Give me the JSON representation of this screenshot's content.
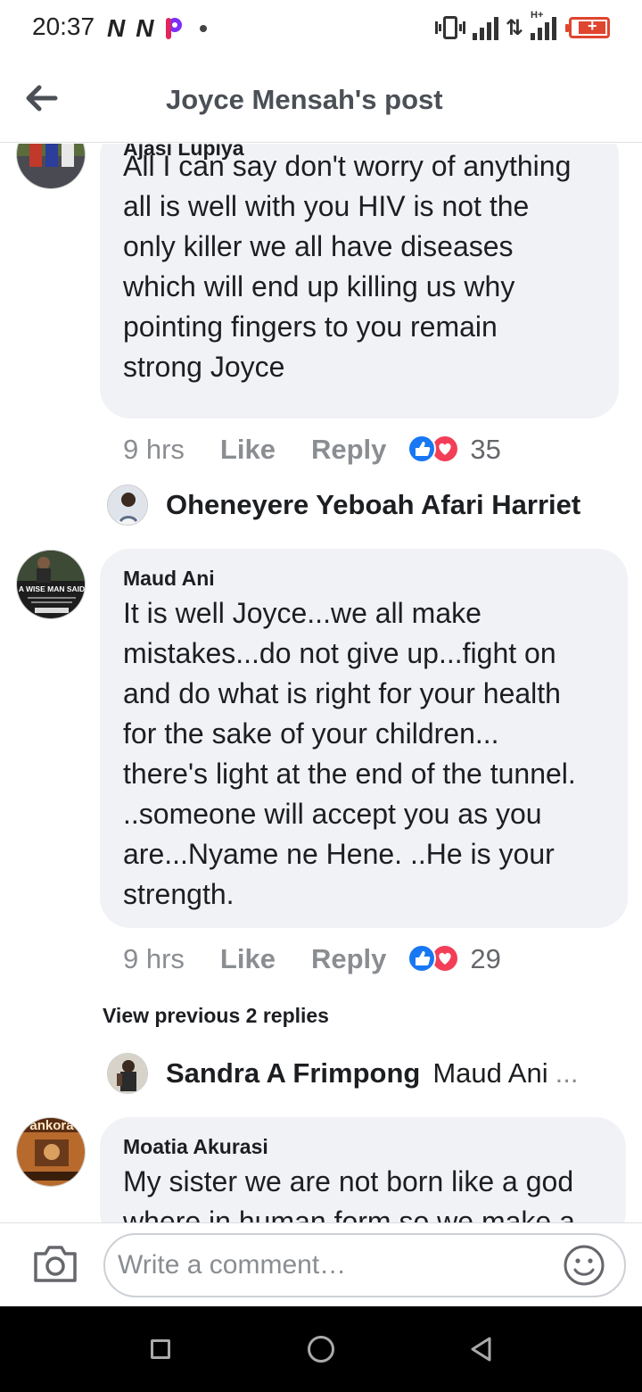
{
  "status_bar": {
    "time": "20:37",
    "icons": [
      "netflix-n-icon",
      "netflix-n-icon",
      "picsart-p-icon",
      "notification-dot-icon",
      "vibrate-icon",
      "signal-icon",
      "data-arrows-icon",
      "signal-hplus-icon",
      "battery-charging-icon"
    ],
    "data_arrows": "⇅",
    "hplus_label": "H+"
  },
  "header": {
    "title": "Joyce Mensah's post",
    "back_icon": "arrow-left-icon"
  },
  "comments": [
    {
      "author": "Ajasi Lupiya",
      "text": "All I can say don't worry of anything all is well with you HIV is not the only killer we all have diseases which will end up killing us why pointing fingers to you remain strong Joyce",
      "lines": [
        "All I can say don't worry of anything",
        "all is well with you HIV is not the",
        "only killer we all have diseases",
        "which will end up killing us why",
        "pointing fingers to you remain",
        "strong Joyce"
      ],
      "time": "9 hrs",
      "like_label": "Like",
      "reply_label": "Reply",
      "reactions": [
        "like",
        "love"
      ],
      "reaction_count": "35",
      "reply_preview": {
        "name": "Oheneyere Yeboah Afari Harriet",
        "snippet": ""
      }
    },
    {
      "author": "Maud Ani",
      "avatar_text": "A WISE MAN SAID",
      "text": "It is well Joyce...we all make mistakes...do not give up...fight on and do what is right for your health for the sake of your children... there's light at the end of the tunnel. ..someone will accept you as you are...Nyame ne Hene. ..He is your strength.",
      "lines": [
        "It is well Joyce...we all make",
        "mistakes...do not give up...fight on",
        "and do what is right for your health",
        "for the sake of your children...",
        "there's light at the end of the tunnel.",
        "..someone will accept you as you",
        "are...Nyame ne Hene. ..He is your",
        "strength."
      ],
      "time": "9 hrs",
      "like_label": "Like",
      "reply_label": "Reply",
      "reactions": [
        "like",
        "love"
      ],
      "reaction_count": "29",
      "view_previous": "View previous 2 replies",
      "reply_preview": {
        "name": "Sandra A Frimpong",
        "snippet": "Maud Ani",
        "ellipsis": "..."
      }
    },
    {
      "author": "Moatia Akurasi",
      "avatar_text": "ankora",
      "lines": [
        "My sister we are not born like a god",
        "where in human form so we make a"
      ]
    }
  ],
  "composer": {
    "placeholder": "Write a comment…",
    "camera_icon": "camera-icon",
    "emoji_icon": "smiley-icon"
  },
  "nav_bar": {
    "icons": [
      "recents-square-icon",
      "home-circle-icon",
      "back-triangle-icon"
    ]
  },
  "colors": {
    "bubble": "#f0f2f5",
    "like_blue": "#1877f2",
    "love_red": "#f33e58",
    "meta_gray": "#8a8d91",
    "battery_red": "#e0452f"
  }
}
